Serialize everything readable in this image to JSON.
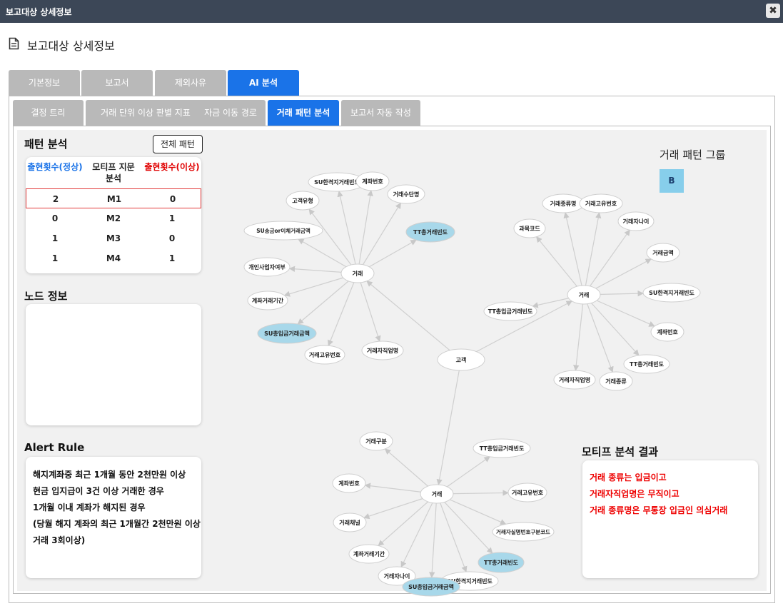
{
  "window": {
    "title": "보고대상 상세정보",
    "close_label": "✖"
  },
  "header": {
    "title": "보고대상 상세정보",
    "icon": "document-icon"
  },
  "tabs": [
    {
      "label": "기본정보",
      "active": false
    },
    {
      "label": "보고서",
      "active": false
    },
    {
      "label": "제외사유",
      "active": false
    },
    {
      "label": "AI 분석",
      "active": true
    }
  ],
  "subtabs": [
    {
      "label": "결정 트리",
      "active": false
    },
    {
      "label": "거래 단위 이상 판별 지표",
      "active": false
    },
    {
      "label": "자금 이동 경로",
      "active": false
    },
    {
      "label": "거래 패턴 분석",
      "active": true
    },
    {
      "label": "보고서 자동 작성",
      "active": false
    }
  ],
  "pattern": {
    "title": "패턴 분석",
    "all_button": "전체 패턴",
    "headers": {
      "normal": "출현횟수(정상)",
      "motif": "모티프 지문\n분석",
      "abnormal": "출현횟수(이상)"
    },
    "rows": [
      {
        "normal": "2",
        "motif": "M1",
        "abnormal": "0",
        "selected": true
      },
      {
        "normal": "0",
        "motif": "M2",
        "abnormal": "1",
        "selected": false
      },
      {
        "normal": "1",
        "motif": "M3",
        "abnormal": "0",
        "selected": false
      },
      {
        "normal": "1",
        "motif": "M4",
        "abnormal": "1",
        "selected": false
      }
    ],
    "normal_color": "#1a73e8",
    "abnormal_color": "#e00000"
  },
  "node_info": {
    "title": "노드 정보"
  },
  "alert_rule": {
    "title": "Alert Rule",
    "lines": [
      "해지계좌중 최근 1개월 동안 2천만원 이상",
      "현금 입지급이 3건 이상 거래한 경우",
      "1개월 이내 계좌가 해지된 경우",
      "(당월 해지 계좌의 최근 1개월간 2천만원 이상",
      "거래 3회이상)"
    ]
  },
  "legend": {
    "title": "거래 패턴 그룹",
    "group_label": "B",
    "group_color": "#87ceeb"
  },
  "motif_result": {
    "title": "모티프 분석 결과",
    "lines": [
      "거래 종류는 입금이고",
      "거래자직업명은 무직이고",
      "거래 종류명은 무통장 입금인 의심거래"
    ]
  },
  "graph": {
    "nodes": [
      {
        "id": "c",
        "label": "고객",
        "hl": false
      },
      {
        "id": "h1",
        "label": "거래",
        "hl": false
      },
      {
        "id": "h2",
        "label": "거래",
        "hl": false
      },
      {
        "id": "h3",
        "label": "거래",
        "hl": false
      },
      {
        "id": "a1",
        "label": "SU한격지거래빈도",
        "hl": false
      },
      {
        "id": "a2",
        "label": "계좌번호",
        "hl": false
      },
      {
        "id": "a3",
        "label": "고객유형",
        "hl": false
      },
      {
        "id": "a4",
        "label": "거래수단명",
        "hl": false
      },
      {
        "id": "a5",
        "label": "SU송금or이체거래금액",
        "hl": false
      },
      {
        "id": "a6",
        "label": "TT총거래빈도",
        "hl": true
      },
      {
        "id": "a7",
        "label": "개인사업자여부",
        "hl": false
      },
      {
        "id": "a8",
        "label": "계좌거래기간",
        "hl": false
      },
      {
        "id": "a9",
        "label": "SU총입금거래금액",
        "hl": true
      },
      {
        "id": "a10",
        "label": "거래고유번호",
        "hl": false
      },
      {
        "id": "a11",
        "label": "거래자직업명",
        "hl": false
      },
      {
        "id": "b1",
        "label": "거래종류명",
        "hl": false
      },
      {
        "id": "b2",
        "label": "거래고유번호",
        "hl": false
      },
      {
        "id": "b3",
        "label": "과목코드",
        "hl": false
      },
      {
        "id": "b4",
        "label": "거래자나이",
        "hl": false
      },
      {
        "id": "b5",
        "label": "거래금액",
        "hl": false
      },
      {
        "id": "b6",
        "label": "TT총입금거래빈도",
        "hl": false
      },
      {
        "id": "b7",
        "label": "SU한격지거래빈도",
        "hl": false
      },
      {
        "id": "b8",
        "label": "계좌번호",
        "hl": false
      },
      {
        "id": "b9",
        "label": "TT총거래빈도",
        "hl": false
      },
      {
        "id": "b10",
        "label": "거래자직업명",
        "hl": false
      },
      {
        "id": "b11",
        "label": "거래종류",
        "hl": false
      },
      {
        "id": "d1",
        "label": "거래구분",
        "hl": false
      },
      {
        "id": "d2",
        "label": "TT총입금거래빈도",
        "hl": false
      },
      {
        "id": "d3",
        "label": "계좌번호",
        "hl": false
      },
      {
        "id": "d4",
        "label": "거래고유번호",
        "hl": false
      },
      {
        "id": "d5",
        "label": "거래채널",
        "hl": false
      },
      {
        "id": "d6",
        "label": "거래자실명번호구분코드",
        "hl": false
      },
      {
        "id": "d7",
        "label": "계좌거래기간",
        "hl": false
      },
      {
        "id": "d8",
        "label": "TT총거래빈도",
        "hl": true
      },
      {
        "id": "d9",
        "label": "거래자나이",
        "hl": false
      },
      {
        "id": "d10",
        "label": "SU한격지거래빈도",
        "hl": false
      },
      {
        "id": "d11",
        "label": "SU총입금거래금액",
        "hl": true
      }
    ],
    "edges": [
      [
        "c",
        "h1"
      ],
      [
        "c",
        "h2"
      ],
      [
        "c",
        "h3"
      ],
      [
        "h1",
        "a1"
      ],
      [
        "h1",
        "a2"
      ],
      [
        "h1",
        "a3"
      ],
      [
        "h1",
        "a4"
      ],
      [
        "h1",
        "a5"
      ],
      [
        "h1",
        "a6"
      ],
      [
        "h1",
        "a7"
      ],
      [
        "h1",
        "a8"
      ],
      [
        "h1",
        "a9"
      ],
      [
        "h1",
        "a10"
      ],
      [
        "h1",
        "a11"
      ],
      [
        "h2",
        "b1"
      ],
      [
        "h2",
        "b2"
      ],
      [
        "h2",
        "b3"
      ],
      [
        "h2",
        "b4"
      ],
      [
        "h2",
        "b5"
      ],
      [
        "h2",
        "b6"
      ],
      [
        "h2",
        "b7"
      ],
      [
        "h2",
        "b8"
      ],
      [
        "h2",
        "b9"
      ],
      [
        "h2",
        "b10"
      ],
      [
        "h2",
        "b11"
      ],
      [
        "h3",
        "d1"
      ],
      [
        "h3",
        "d2"
      ],
      [
        "h3",
        "d3"
      ],
      [
        "h3",
        "d4"
      ],
      [
        "h3",
        "d5"
      ],
      [
        "h3",
        "d6"
      ],
      [
        "h3",
        "d7"
      ],
      [
        "h3",
        "d8"
      ],
      [
        "h3",
        "d9"
      ],
      [
        "h3",
        "d10"
      ],
      [
        "h3",
        "d11"
      ]
    ]
  }
}
